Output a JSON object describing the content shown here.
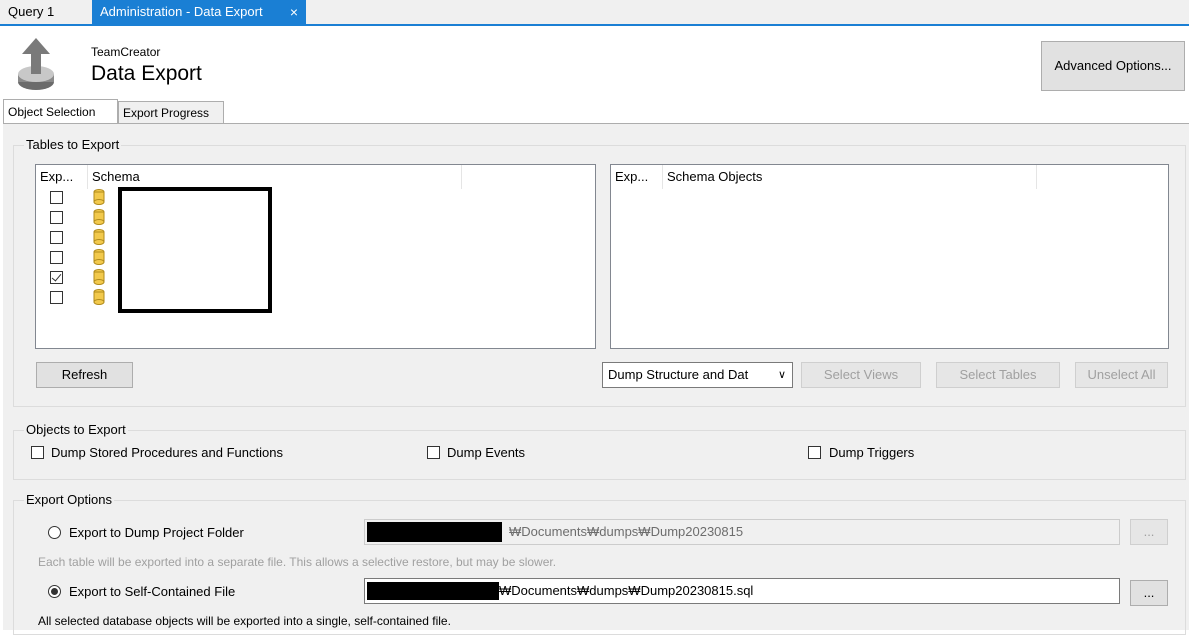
{
  "doc_tabs": {
    "query": "Query 1",
    "admin": "Administration - Data Export",
    "close_glyph": "×"
  },
  "header": {
    "subtitle": "TeamCreator",
    "title": "Data Export",
    "icon": "export-upload-icon"
  },
  "advanced_button": "Advanced Options...",
  "inner_tabs": {
    "object_selection": "Object Selection",
    "export_progress": "Export Progress"
  },
  "tables_to_export": {
    "title": "Tables to Export",
    "left_list": {
      "col_export": "Exp...",
      "col_schema": "Schema",
      "checked": [
        false,
        false,
        false,
        false,
        true,
        false
      ]
    },
    "right_list": {
      "col_export": "Exp...",
      "col_objects": "Schema Objects"
    },
    "refresh": "Refresh",
    "dump_mode": "Dump Structure and Dat",
    "select_views": "Select Views",
    "select_tables": "Select Tables",
    "unselect_all": "Unselect All"
  },
  "objects_to_export": {
    "title": "Objects to Export",
    "stored_procs": "Dump Stored Procedures and Functions",
    "events": "Dump Events",
    "triggers": "Dump Triggers"
  },
  "export_options": {
    "title": "Export Options",
    "project_folder": "Export to Dump Project Folder",
    "project_folder_path": "₩Documents₩dumps₩Dump20230815",
    "project_folder_note": "Each table will be exported into a separate file. This allows a selective restore, but may be slower.",
    "self_contained": "Export to Self-Contained File",
    "self_contained_path": "₩Documents₩dumps₩Dump20230815.sql",
    "self_contained_note": "All selected database objects will be exported into a single, self-contained file.",
    "browse": "...",
    "selected": "self_contained"
  },
  "colors": {
    "accent": "#1a7fd4",
    "panel": "#f0f0f0",
    "disabled_text": "#a0a0a0"
  }
}
